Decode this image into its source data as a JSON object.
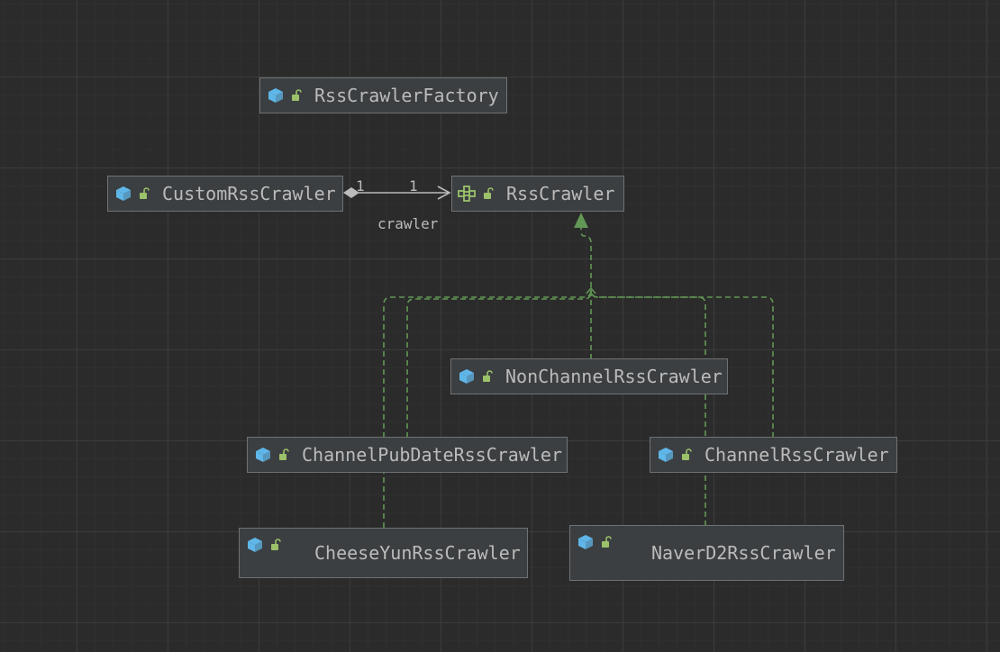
{
  "diagram": {
    "colors": {
      "background": "#2b2b2b",
      "node_fill": "#3c3f41",
      "node_border": "#6f7275",
      "text": "#bbbbbb",
      "class_icon": "#5fb6e8",
      "lock_icon": "#9bc26a",
      "inheritance_edge": "#629755",
      "association_edge": "#bbbbbb"
    },
    "nodes": [
      {
        "id": "rss-crawler-factory",
        "label": "RssCrawlerFactory",
        "kind": "class",
        "icon": "class-icon"
      },
      {
        "id": "custom-rss-crawler",
        "label": "CustomRssCrawler",
        "kind": "class",
        "icon": "class-icon"
      },
      {
        "id": "rss-crawler",
        "label": "RssCrawler",
        "kind": "interface",
        "icon": "interface-icon"
      },
      {
        "id": "non-channel-rss-crawler",
        "label": "NonChannelRssCrawler",
        "kind": "class",
        "icon": "class-icon"
      },
      {
        "id": "channel-pub-date-rss-crawler",
        "label": "ChannelPubDateRssCrawler",
        "kind": "class",
        "icon": "class-icon"
      },
      {
        "id": "channel-rss-crawler",
        "label": "ChannelRssCrawler",
        "kind": "class",
        "icon": "class-icon"
      },
      {
        "id": "cheese-yun-rss-crawler",
        "label": "CheeseYunRssCrawler",
        "kind": "class",
        "icon": "class-icon"
      },
      {
        "id": "naver-d2-rss-crawler",
        "label": "NaverD2RssCrawler",
        "kind": "class",
        "icon": "class-icon"
      }
    ],
    "association": {
      "from": "custom-rss-crawler",
      "to": "rss-crawler",
      "type": "composition",
      "source_multiplicity": "1",
      "target_multiplicity": "1",
      "role": "crawler"
    },
    "inheritance": {
      "target": "rss-crawler",
      "style": "dashed",
      "sources": [
        "non-channel-rss-crawler",
        "channel-pub-date-rss-crawler",
        "channel-rss-crawler",
        "cheese-yun-rss-crawler",
        "naver-d2-rss-crawler"
      ]
    }
  }
}
